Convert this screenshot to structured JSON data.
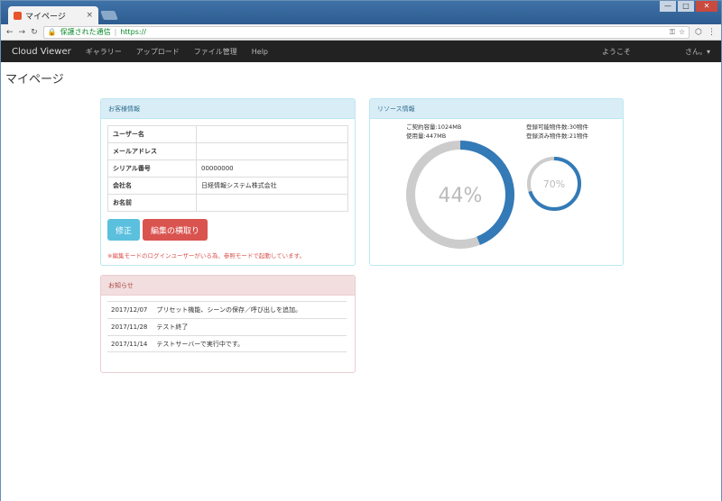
{
  "browser": {
    "tab_title": "マイページ",
    "tab_close": "×",
    "address_secure": "保護された通信",
    "address_url": "https://"
  },
  "nav": {
    "brand": "Cloud Viewer",
    "links": [
      "ギャラリー",
      "アップロード",
      "ファイル管理",
      "Help"
    ],
    "welcome": "ようこそ",
    "user": "さん。▾"
  },
  "page": {
    "title": "マイページ"
  },
  "customer": {
    "heading": "お客様情報",
    "rows": [
      {
        "label": "ユーザー名",
        "value": ""
      },
      {
        "label": "メールアドレス",
        "value": ""
      },
      {
        "label": "シリアル番号",
        "value": "00000000"
      },
      {
        "label": "会社名",
        "value": "日経情報システム株式会社"
      },
      {
        "label": "お名前",
        "value": ""
      }
    ],
    "edit_button": "修正",
    "cancel_button": "編集の横取り",
    "warning": "※編集モードのログインユーザーがいる為、参照モードで起動しています。"
  },
  "resource": {
    "heading": "リソース情報",
    "capacity": "ご契約容量:1024MB",
    "used": "使用量:447MB",
    "registrable": "登録可能物件数:30物件",
    "registered": "登録済み物件数:21物件",
    "storage_percent": 44,
    "storage_label": "44%",
    "objects_percent": 70,
    "objects_label": "70%",
    "colors": {
      "fill": "#337ab7",
      "track": "#cccccc",
      "label": "#bbbbbb"
    }
  },
  "news": {
    "heading": "お知らせ",
    "items": [
      {
        "date": "2017/12/07",
        "text": "プリセット機能、シーンの保存／呼び出しを追加。"
      },
      {
        "date": "2017/11/28",
        "text": "テスト終了"
      },
      {
        "date": "2017/11/14",
        "text": "テストサーバーで実行中です。"
      }
    ]
  }
}
